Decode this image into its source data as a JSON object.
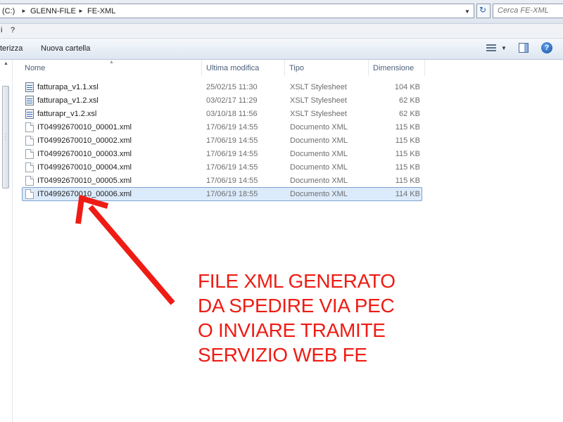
{
  "address": {
    "drive_label": "(C:)",
    "crumbs": [
      "GLENN-FILE",
      "FE-XML"
    ]
  },
  "search": {
    "placeholder": "Cerca FE-XML"
  },
  "menu": {
    "items": [
      "i",
      "?"
    ]
  },
  "toolbar": {
    "organize_label": "terizza",
    "new_folder_label": "Nuova cartella"
  },
  "columns": {
    "name": "Nome",
    "modified": "Ultima modifica",
    "type": "Tipo",
    "size": "Dimensione"
  },
  "files": [
    {
      "name": "fatturapa_v1.1.xsl",
      "modified": "25/02/15 11:30",
      "type": "XSLT Stylesheet",
      "size": "104 KB",
      "icon": "xsl-stylesheet-icon"
    },
    {
      "name": "fatturapa_v1.2.xsl",
      "modified": "03/02/17 11:29",
      "type": "XSLT Stylesheet",
      "size": "62 KB",
      "icon": "xsl-stylesheet-icon"
    },
    {
      "name": "fatturapr_v1.2.xsl",
      "modified": "03/10/18 11:56",
      "type": "XSLT Stylesheet",
      "size": "62 KB",
      "icon": "xsl-stylesheet-icon"
    },
    {
      "name": "IT04992670010_00001.xml",
      "modified": "17/06/19 14:55",
      "type": "Documento XML",
      "size": "115 KB",
      "icon": "xml-document-icon"
    },
    {
      "name": "IT04992670010_00002.xml",
      "modified": "17/06/19 14:55",
      "type": "Documento XML",
      "size": "115 KB",
      "icon": "xml-document-icon"
    },
    {
      "name": "IT04992670010_00003.xml",
      "modified": "17/06/19 14:55",
      "type": "Documento XML",
      "size": "115 KB",
      "icon": "xml-document-icon"
    },
    {
      "name": "IT04992670010_00004.xml",
      "modified": "17/06/19 14:55",
      "type": "Documento XML",
      "size": "115 KB",
      "icon": "xml-document-icon"
    },
    {
      "name": "IT04992670010_00005.xml",
      "modified": "17/06/19 14:55",
      "type": "Documento XML",
      "size": "115 KB",
      "icon": "xml-document-icon"
    },
    {
      "name": "IT04992670010_00006.xml",
      "modified": "17/06/19 18:55",
      "type": "Documento XML",
      "size": "114 KB",
      "icon": "xml-document-icon",
      "selected": true
    }
  ],
  "annotation": {
    "lines": [
      "FILE XML GENERATO",
      "DA SPEDIRE VIA PEC",
      "O INVIARE TRAMITE",
      "SERVIZIO WEB FE"
    ],
    "color": "#ee1c14"
  },
  "colors": {
    "selection_bg": "#dcebfc",
    "selection_border": "#7da2ce",
    "header_text": "#4c607a"
  }
}
